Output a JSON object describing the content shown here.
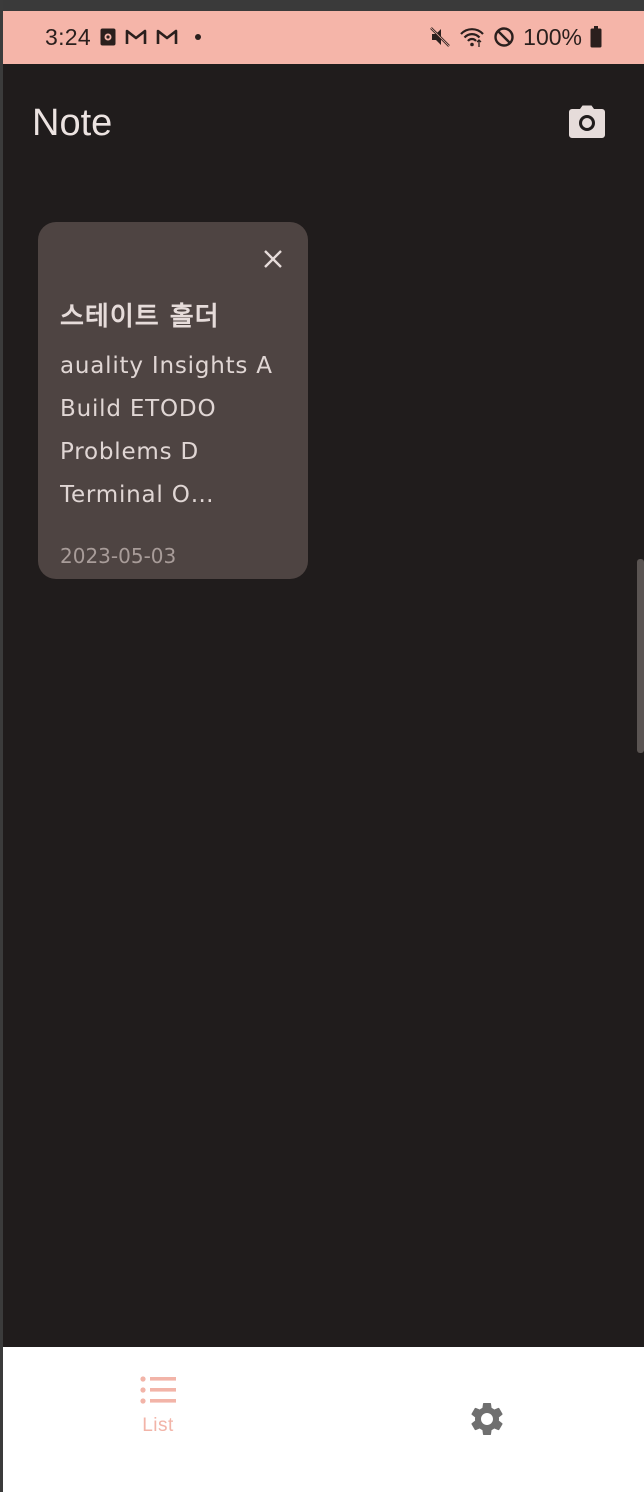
{
  "status_bar": {
    "time": "3:24",
    "battery": "100%",
    "icons_left": [
      "notification-app-icon",
      "gmail-icon",
      "gmail-icon",
      "dot"
    ],
    "icons_right": [
      "mute-icon",
      "wifi-icon",
      "do-not-disturb-icon",
      "battery-icon"
    ],
    "background": "#f5b5a9"
  },
  "app_bar": {
    "title": "Note",
    "action_icon": "camera-icon"
  },
  "notes": [
    {
      "title": "스테이트 홀더",
      "lines": [
        "auality Insights A",
        "Build ETODO",
        "Problems D",
        "Terminal O…"
      ],
      "date": "2023-05-03"
    }
  ],
  "bottom_nav": {
    "items": [
      {
        "label": "List",
        "icon": "list-icon",
        "selected": true
      },
      {
        "label": "",
        "icon": "gear-icon",
        "selected": false
      }
    ],
    "accent": "#f2b4a8"
  },
  "colors": {
    "background": "#201c1c",
    "card": "#4e4442",
    "text_primary": "#ece3e1"
  }
}
